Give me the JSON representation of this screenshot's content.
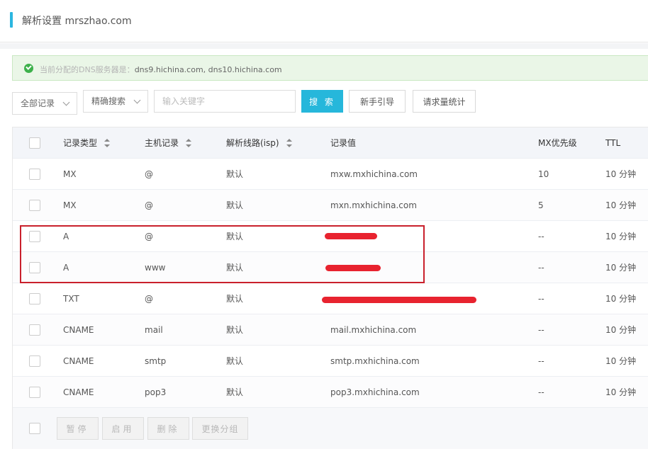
{
  "header": {
    "title": "解析设置 mrszhao.com"
  },
  "notice": {
    "label": "当前分配的DNS服务器是：",
    "servers": "dns9.hichina.com, dns10.hichina.com"
  },
  "toolbar": {
    "record_filter": "全部记录",
    "search_mode": "精确搜索",
    "keyword_placeholder": "输入关键字",
    "search_button": "搜 索",
    "guide_button": "新手引导",
    "stats_button": "请求量统计"
  },
  "table": {
    "columns": {
      "type": "记录类型",
      "host": "主机记录",
      "line": "解析线路(isp)",
      "value": "记录值",
      "mx": "MX优先级",
      "ttl": "TTL"
    },
    "rows": [
      {
        "type": "MX",
        "host": "@",
        "line": "默认",
        "value": "mxw.mxhichina.com",
        "mx": "10",
        "ttl": "10 分钟"
      },
      {
        "type": "MX",
        "host": "@",
        "line": "默认",
        "value": "mxn.mxhichina.com",
        "mx": "5",
        "ttl": "10 分钟"
      },
      {
        "type": "A",
        "host": "@",
        "line": "默认",
        "value": "",
        "mx": "--",
        "ttl": "10 分钟"
      },
      {
        "type": "A",
        "host": "www",
        "line": "默认",
        "value": "",
        "mx": "--",
        "ttl": "10 分钟"
      },
      {
        "type": "TXT",
        "host": "@",
        "line": "默认",
        "value": "",
        "mx": "--",
        "ttl": "10 分钟"
      },
      {
        "type": "CNAME",
        "host": "mail",
        "line": "默认",
        "value": "mail.mxhichina.com",
        "mx": "--",
        "ttl": "10 分钟"
      },
      {
        "type": "CNAME",
        "host": "smtp",
        "line": "默认",
        "value": "smtp.mxhichina.com",
        "mx": "--",
        "ttl": "10 分钟"
      },
      {
        "type": "CNAME",
        "host": "pop3",
        "line": "默认",
        "value": "pop3.mxhichina.com",
        "mx": "--",
        "ttl": "10 分钟"
      }
    ]
  },
  "footer": {
    "pause_button": "暂停",
    "enable_button": "启用",
    "delete_button": "删除",
    "regroup_button": "更换分组"
  },
  "colors": {
    "accent": "#26b7db",
    "success": "#3db14b",
    "redaction": "#e8232f",
    "highlight_border": "#c9202c"
  }
}
